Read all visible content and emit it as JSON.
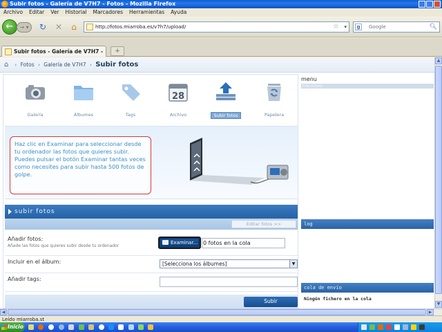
{
  "window": {
    "title": "Subir fotos - Galería de V7H7 - Fotos - Mozilla Firefox"
  },
  "menubar": [
    "Archivo",
    "Editar",
    "Ver",
    "Historial",
    "Marcadores",
    "Herramientas",
    "Ayuda"
  ],
  "navbar": {
    "url": "http://fotos.miarroba.es/v7h7/upload/",
    "search_placeholder": "Google"
  },
  "tabs": [
    {
      "label": "Subir fotos - Galería de V7H7 - Fotos"
    }
  ],
  "breadcrumb": {
    "items": [
      "Fotos",
      "Galería de V7H7"
    ],
    "current": "Subir fotos"
  },
  "gallery_nav": [
    {
      "label": "Galería",
      "icon": "camera-icon"
    },
    {
      "label": "Álbumes",
      "icon": "folder-icon"
    },
    {
      "label": "Tags",
      "icon": "tag-icon"
    },
    {
      "label": "Archivo",
      "icon": "calendar-icon",
      "day": "28"
    },
    {
      "label": "Subir fotos",
      "icon": "upload-icon",
      "active": true
    },
    {
      "label": "Papelera",
      "icon": "recycle-bin-icon"
    }
  ],
  "promo": {
    "text": "Haz clic en Examinar para seleccionar desde tu ordenador las fotos que quieres subir. Puedes pulsar el botón Examinar tantas veces como necesites para subir hasta 500 fotos de golpe."
  },
  "upload": {
    "section_title": "subir fotos",
    "edit_button": "Editar fotos >>",
    "add_photos_label": "Añadir fotos:",
    "add_photos_hint": "Añade las fotos que quieres subir desde tu ordenador",
    "browse_button": "Examinar...",
    "queue_text": "0 fotos en la cola",
    "album_label": "Incluir en el álbum:",
    "album_selected": "[Selecciona los álbumes]",
    "tags_label": "Añadir tags:",
    "tags_value": "",
    "submit_button": "Subir"
  },
  "sidebar": {
    "menu_title": "menu",
    "menu_sub": "PUBLICIDAD",
    "log_title": "log",
    "queue_title": "cola de envío",
    "queue_empty": "Ningún fichero en la cola"
  },
  "status": {
    "text": "Leído miarroba.st"
  },
  "taskbar": {
    "start_label": "Inicio"
  },
  "colors": {
    "accent_blue": "#2563a6",
    "promo_text": "#3f8fc6",
    "note_border": "#d13a3a"
  }
}
